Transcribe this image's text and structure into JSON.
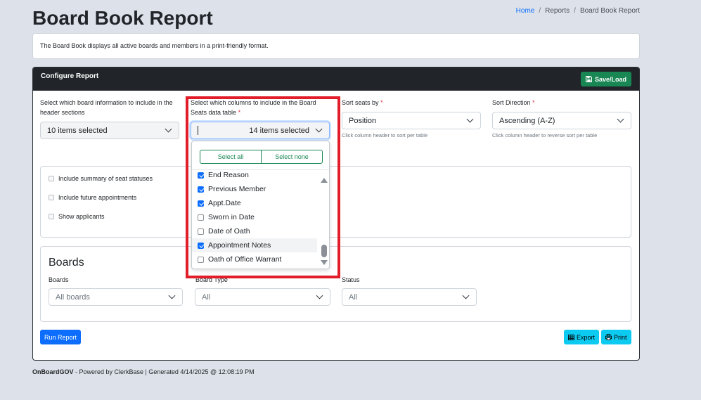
{
  "page": {
    "title": "Board Book Report",
    "breadcrumb": [
      "Home",
      "Reports",
      "Board Book Report"
    ],
    "description": "The Board Book displays all active boards and members in a print-friendly format."
  },
  "config": {
    "header_title": "Configure Report",
    "save_load_label": "Save/Load",
    "header_sections": {
      "label": "Select which board information to include in the header sections",
      "value": "10 items selected"
    },
    "columns": {
      "label": "Select which columns to include in the Board Seats data table",
      "required": "*",
      "value": "14 items selected"
    },
    "sort_seats": {
      "label": "Sort seats by",
      "required": "*",
      "value": "Position",
      "hint": "Click column header to sort per table"
    },
    "sort_direction": {
      "label": "Sort Direction",
      "required": "*",
      "value": "Ascending (A-Z)",
      "hint": "Click column header to reverse sort per table"
    },
    "options": [
      {
        "label": "Include summary of seat statuses",
        "checked": false
      },
      {
        "label": "Include future appointments",
        "checked": false
      },
      {
        "label": "Show applicants",
        "checked": false
      }
    ],
    "boards_section": {
      "title": "Boards",
      "boards_label": "Boards",
      "boards_value": "All boards",
      "board_type_label": "Board Type",
      "board_type_value": "All",
      "status_label": "Status",
      "status_value": "All"
    },
    "run_report_label": "Run Report",
    "export_label": "Export",
    "print_label": "Print"
  },
  "dropdown": {
    "select_all_label": "Select all",
    "select_none_label": "Select none",
    "items": [
      {
        "label": "End Reason",
        "checked": true
      },
      {
        "label": "Previous Member",
        "checked": true
      },
      {
        "label": "Appt.Date",
        "checked": true
      },
      {
        "label": "Sworn in Date",
        "checked": false
      },
      {
        "label": "Date of Oath",
        "checked": false
      },
      {
        "label": "Appointment Notes",
        "checked": true
      },
      {
        "label": "Oath of Office Warrant",
        "checked": false
      }
    ]
  },
  "footer": {
    "brand": "OnBoardGOV",
    "text": " - Powered by ClerkBase | Generated 4/14/2025 @ 12:08:19 PM"
  },
  "colors": {
    "header_bg": "#212529",
    "save_button": "#198754",
    "run_button": "#0d6efd",
    "export_print_buttons": "#0dcaf0",
    "highlight_box": "#e11d2a",
    "checkbox_checked": "#0d6efd"
  },
  "icons": {
    "save": "floppy-disk-icon",
    "export": "table-icon",
    "print": "printer-icon"
  }
}
